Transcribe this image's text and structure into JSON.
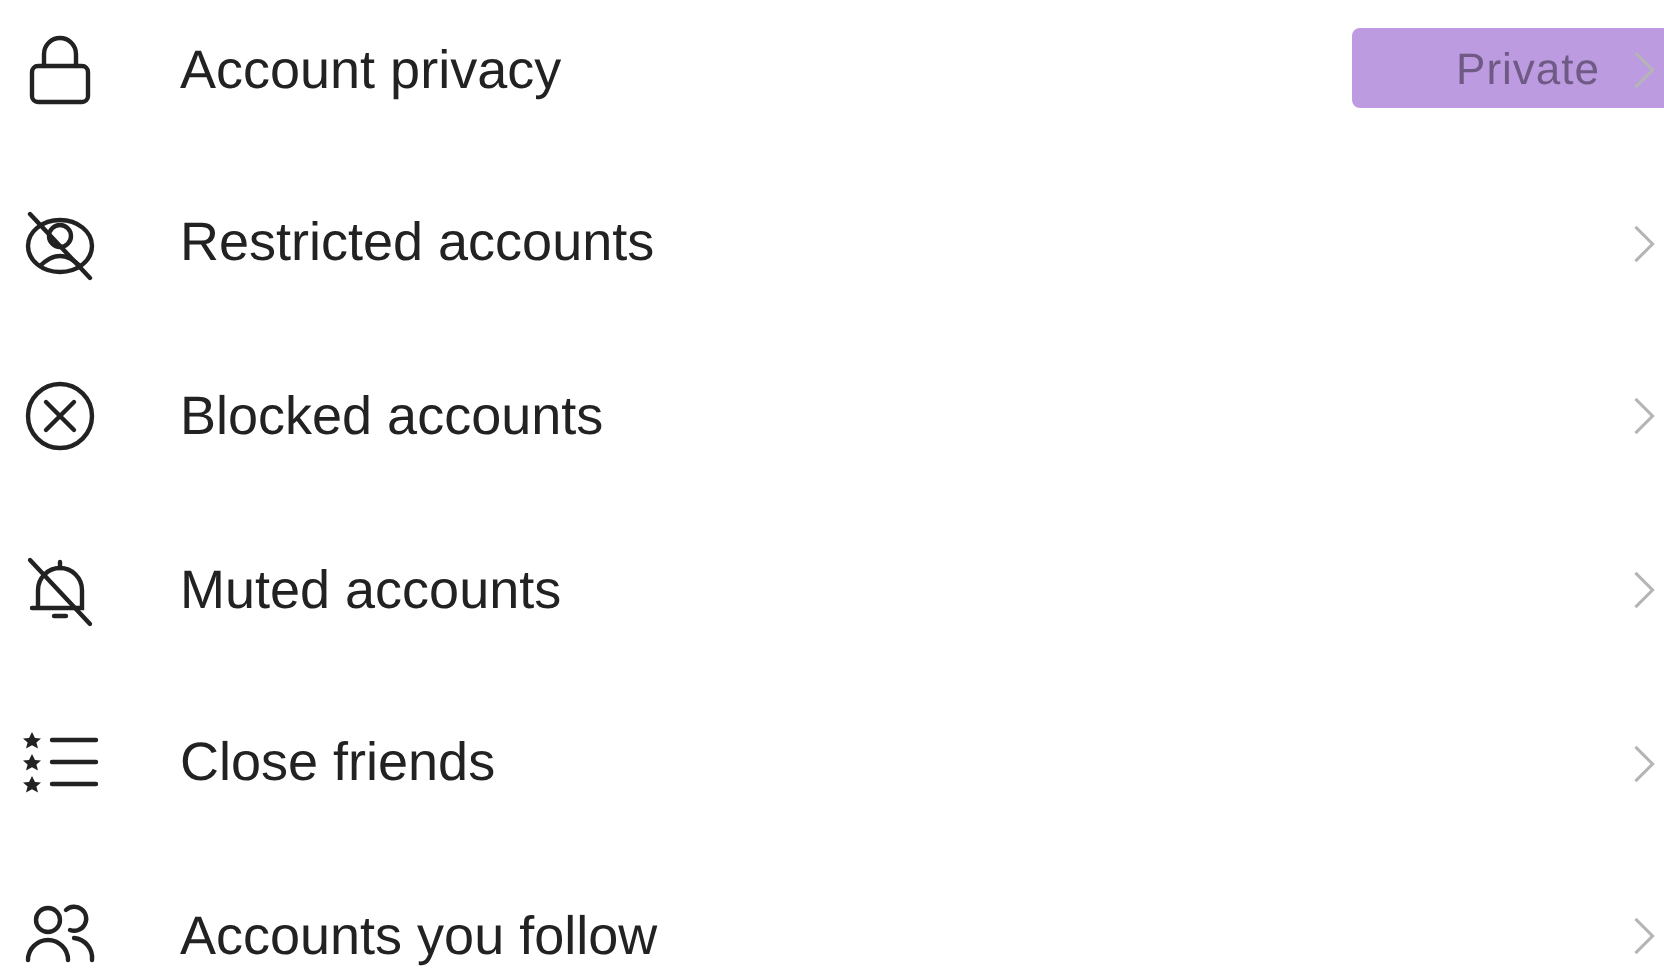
{
  "items": [
    {
      "kind": "lock",
      "label": "Account privacy",
      "value": "Private",
      "highlighted": true
    },
    {
      "kind": "restricted",
      "label": "Restricted accounts"
    },
    {
      "kind": "blocked",
      "label": "Blocked accounts"
    },
    {
      "kind": "muted",
      "label": "Muted accounts"
    },
    {
      "kind": "close-friends",
      "label": "Close friends"
    },
    {
      "kind": "following",
      "label": "Accounts you follow"
    }
  ]
}
